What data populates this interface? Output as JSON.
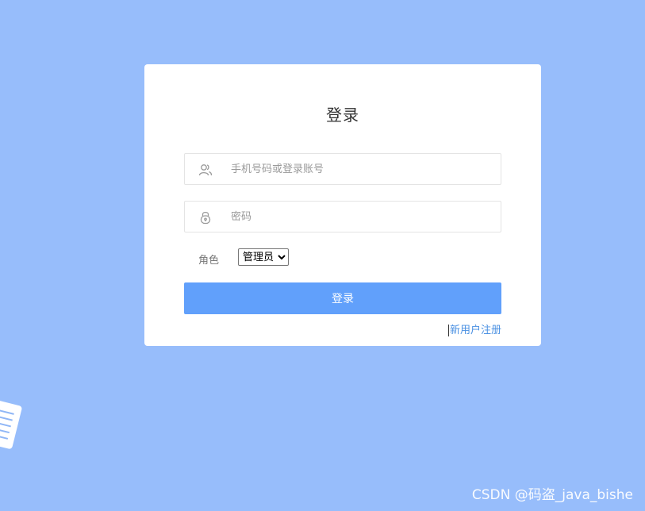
{
  "login": {
    "title": "登录",
    "account": {
      "placeholder": "手机号码或登录账号",
      "value": ""
    },
    "password": {
      "placeholder": "密码",
      "value": ""
    },
    "role": {
      "label": "角色",
      "selected": "管理员",
      "options": [
        "管理员"
      ]
    },
    "submit_label": "登录",
    "register_link": "新用户注册"
  },
  "colors": {
    "background": "#97bdfb",
    "card": "#ffffff",
    "button": "#61a0fb",
    "link": "#4a90e2"
  },
  "icons": {
    "account": "user-icon",
    "password": "lock-icon"
  },
  "watermark": "CSDN @码盗_java_bishe"
}
